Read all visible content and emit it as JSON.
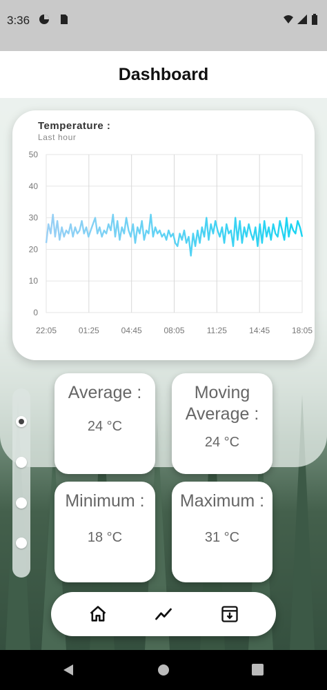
{
  "status_bar": {
    "time": "3:36"
  },
  "app_bar": {
    "title": "Dashboard"
  },
  "chart_card": {
    "title": "Temperature :",
    "subtitle": "Last hour"
  },
  "chart_data": {
    "type": "line",
    "title": "Temperature :",
    "subtitle": "Last hour",
    "ylim": [
      0,
      50
    ],
    "y_ticks": [
      "0",
      "10",
      "20",
      "30",
      "40",
      "50"
    ],
    "x_ticks": [
      "22:05",
      "01:25",
      "04:45",
      "08:05",
      "11:25",
      "14:45",
      "18:05"
    ],
    "grid": true,
    "series": [
      {
        "color_start": "#9ad0f5",
        "color_end": "#19d4f2",
        "values": [
          22,
          28,
          25,
          31,
          24,
          29,
          23,
          27,
          24,
          26,
          25,
          28,
          24,
          27,
          25,
          26,
          29,
          25,
          27,
          24,
          26,
          28,
          30,
          25,
          27,
          24,
          26,
          25,
          28,
          26,
          31,
          24,
          29,
          23,
          27,
          25,
          30,
          26,
          24,
          28,
          22,
          27,
          25,
          29,
          23,
          26,
          25,
          31,
          24,
          27,
          25,
          26,
          24,
          25,
          23,
          26,
          24,
          25,
          22,
          21,
          25,
          23,
          26,
          22,
          24,
          18,
          25,
          21,
          26,
          22,
          27,
          24,
          30,
          23,
          28,
          25,
          29,
          26,
          24,
          27,
          22,
          28,
          25,
          26,
          21,
          30,
          23,
          29,
          22,
          27,
          24,
          28,
          25,
          23,
          27,
          21,
          28,
          22,
          29,
          24,
          27,
          23,
          28,
          25,
          24,
          29,
          26,
          23,
          30,
          24,
          28,
          26,
          25,
          29,
          27,
          24
        ]
      }
    ]
  },
  "stats": [
    {
      "label": "Average :",
      "value": "24 °C"
    },
    {
      "label": "Moving Average :",
      "value": "24 °C"
    },
    {
      "label": "Minimum :",
      "value": "18 °C"
    },
    {
      "label": "Maximum :",
      "value": "31 °C"
    }
  ],
  "page_indicator": {
    "count": 4,
    "active": 0
  },
  "bottom_nav": [
    {
      "icon": "home-icon"
    },
    {
      "icon": "chart-line-icon"
    },
    {
      "icon": "archive-download-icon"
    }
  ],
  "colors": {
    "accent": "#19d4f2",
    "statusbar": "#c9c9c9"
  }
}
